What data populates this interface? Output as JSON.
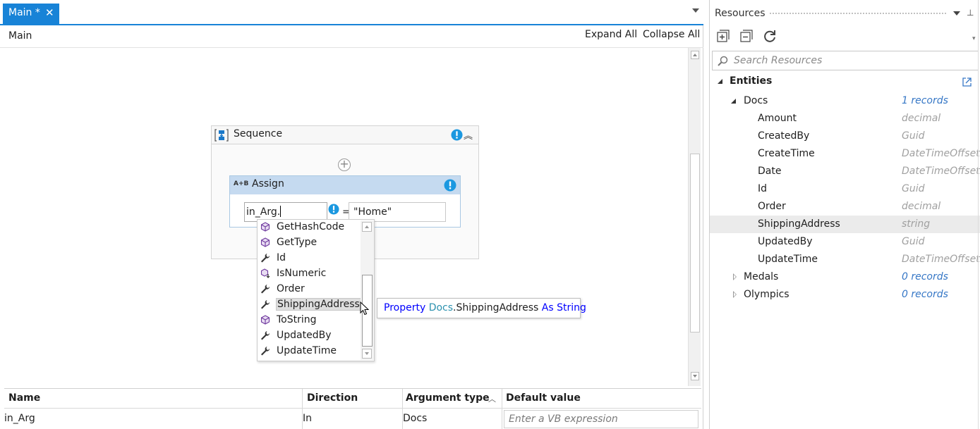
{
  "tabs": [
    {
      "label": "Main *"
    }
  ],
  "designer": {
    "breadcrumb": "Main",
    "expand_all": "Expand All",
    "collapse_all": "Collapse All"
  },
  "sequence": {
    "title": "Sequence"
  },
  "assign": {
    "title": "Assign",
    "icon_text": "A+B",
    "to_value": "in_Arg.",
    "equals": "=",
    "value": "\"Home\""
  },
  "intellisense": {
    "items": [
      {
        "label": "GetHashCode",
        "icon": "method-icon"
      },
      {
        "label": "GetType",
        "icon": "method-icon"
      },
      {
        "label": "Id",
        "icon": "property-icon"
      },
      {
        "label": "IsNumeric",
        "icon": "extension-method-icon"
      },
      {
        "label": "Order",
        "icon": "property-icon"
      },
      {
        "label": "ShippingAddress",
        "icon": "property-icon",
        "selected": true
      },
      {
        "label": "ToString",
        "icon": "method-icon"
      },
      {
        "label": "UpdatedBy",
        "icon": "property-icon"
      },
      {
        "label": "UpdateTime",
        "icon": "property-icon"
      }
    ],
    "tooltip": {
      "kw1": "Property",
      "type1": "Docs",
      "member": ".ShippingAddress",
      "kw2": "As",
      "kw3": "String"
    }
  },
  "arguments": {
    "headers": {
      "name": "Name",
      "direction": "Direction",
      "type": "Argument type",
      "default": "Default value"
    },
    "rows": [
      {
        "name": "in_Arg",
        "direction": "In",
        "type": "Docs",
        "default_placeholder": "Enter a VB expression"
      }
    ]
  },
  "resources": {
    "title": "Resources",
    "search_placeholder": "Search Resources",
    "tree": {
      "root": "Entities",
      "docs": {
        "label": "Docs",
        "count": "1 records",
        "fields": [
          {
            "name": "Amount",
            "type": "decimal"
          },
          {
            "name": "CreatedBy",
            "type": "Guid"
          },
          {
            "name": "CreateTime",
            "type": "DateTimeOffset"
          },
          {
            "name": "Date",
            "type": "DateTimeOffset"
          },
          {
            "name": "Id",
            "type": "Guid"
          },
          {
            "name": "Order",
            "type": "decimal"
          },
          {
            "name": "ShippingAddress",
            "type": "string"
          },
          {
            "name": "UpdatedBy",
            "type": "Guid"
          },
          {
            "name": "UpdateTime",
            "type": "DateTimeOffset"
          }
        ]
      },
      "medals": {
        "label": "Medals",
        "count": "0 records"
      },
      "olympics": {
        "label": "Olympics",
        "count": "0 records"
      }
    }
  },
  "colors": {
    "accent": "#1883d7",
    "warning": "#1b98e0",
    "assign_header": "#c5daf0",
    "type_text": "#a0a0a0",
    "count_text": "#3677c6"
  }
}
